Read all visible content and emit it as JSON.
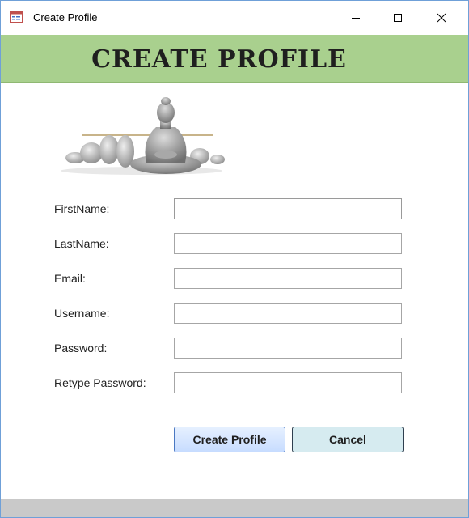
{
  "window": {
    "title": "Create Profile",
    "minimize_glyph": "—",
    "maximize_glyph": "☐",
    "close_glyph": "✕"
  },
  "header": {
    "title": "CREATE PROFILE"
  },
  "hero": {
    "icon": "buddha-statue-image"
  },
  "form": {
    "fields": [
      {
        "label": "FirstName:",
        "value": ""
      },
      {
        "label": "LastName:",
        "value": ""
      },
      {
        "label": "Email:",
        "value": ""
      },
      {
        "label": "Username:",
        "value": ""
      },
      {
        "label": "Password:",
        "value": ""
      },
      {
        "label": "Retype Password:",
        "value": ""
      }
    ]
  },
  "buttons": {
    "create_label": "Create Profile",
    "cancel_label": "Cancel"
  },
  "colors": {
    "header_band": "#a9d08e",
    "create_button": "#c7dcff",
    "cancel_button": "#d6ebf0",
    "bottom_bar": "#c9c9c9"
  }
}
